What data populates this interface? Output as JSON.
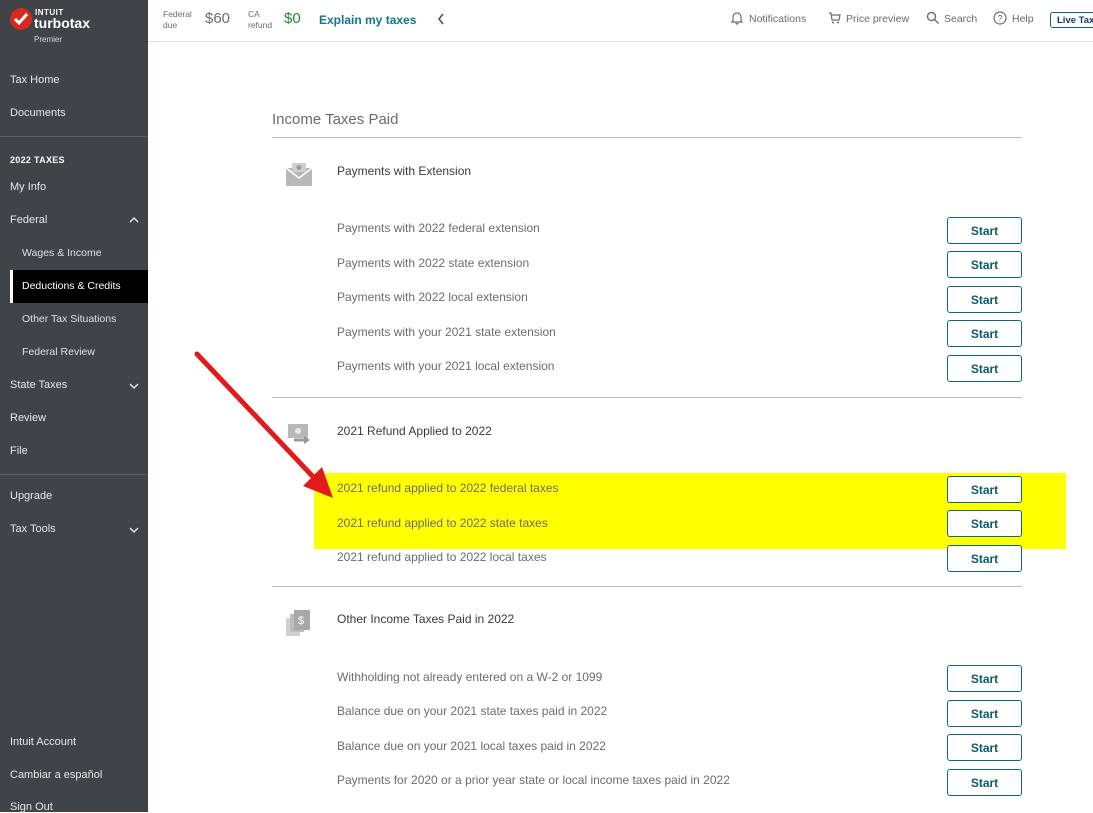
{
  "logo": {
    "intuit": "INTUIT",
    "brand": "turbotax",
    "tier": "Premier"
  },
  "sidebar": {
    "tax_home": "Tax Home",
    "documents": "Documents",
    "section_head": "2022 TAXES",
    "my_info": "My Info",
    "federal": "Federal",
    "wages": "Wages & Income",
    "deductions": "Deductions & Credits",
    "other_tax": "Other Tax Situations",
    "federal_review": "Federal Review",
    "state_taxes": "State Taxes",
    "review": "Review",
    "file": "File",
    "upgrade": "Upgrade",
    "tax_tools": "Tax Tools",
    "intuit_account": "Intuit Account",
    "spanish": "Cambiar a español",
    "sign_out": "Sign Out"
  },
  "topbar": {
    "federal_label_1": "Federal",
    "federal_label_2": "due",
    "federal_amount": "$60",
    "state_label_1": "CA",
    "state_label_2": "refund",
    "state_amount": "$0",
    "explain": "Explain my taxes",
    "notifications": "Notifications",
    "price_preview": "Price preview",
    "search": "Search",
    "help": "Help",
    "live": "Live Tax"
  },
  "main": {
    "title": "Income Taxes Paid",
    "sections": [
      {
        "title": "Payments with Extension",
        "rows": [
          "Payments with 2022 federal extension",
          "Payments with 2022 state extension",
          "Payments with 2022 local extension",
          "Payments with your 2021 state extension",
          "Payments with your 2021 local extension"
        ]
      },
      {
        "title": "2021 Refund Applied to 2022",
        "rows": [
          "2021 refund applied to 2022 federal taxes",
          "2021 refund applied to 2022 state taxes",
          "2021 refund applied to 2022 local taxes"
        ]
      },
      {
        "title": "Other Income Taxes Paid in 2022",
        "rows": [
          "Withholding not already entered on a W-2 or 1099",
          "Balance due on your 2021 state taxes paid in 2022",
          "Balance due on your 2021 local taxes paid in 2022",
          "Payments for 2020 or a prior year state or local income taxes paid in 2022"
        ]
      }
    ],
    "button_label": "Start"
  },
  "colors": {
    "sidebar_bg": "#404347",
    "accent": "#0d6a7a",
    "highlight": "#ffff00",
    "arrow": "#e11b1b"
  }
}
